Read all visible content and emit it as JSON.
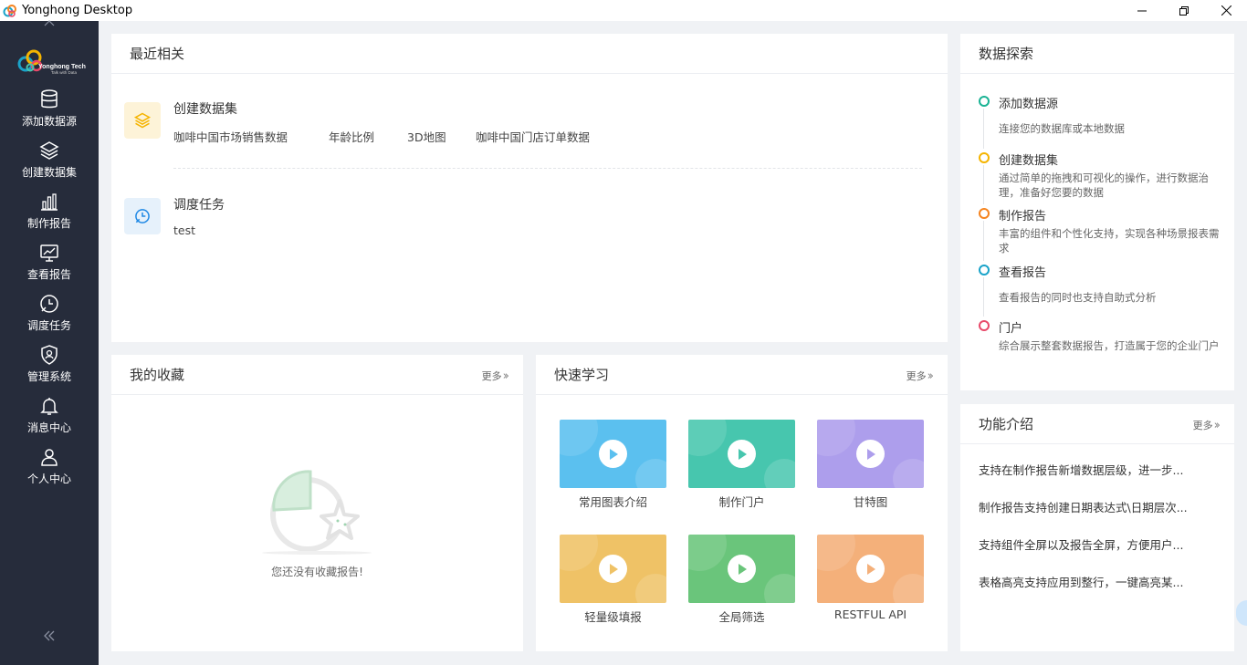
{
  "window": {
    "title": "Yonghong Desktop"
  },
  "sidebar": {
    "brand": {
      "name": "Yonghong Tech",
      "slogan": "Talk with Data"
    },
    "items": [
      {
        "label": "添加数据源",
        "icon": "database-icon"
      },
      {
        "label": "创建数据集",
        "icon": "layers-icon"
      },
      {
        "label": "制作报告",
        "icon": "bar-chart-icon"
      },
      {
        "label": "查看报告",
        "icon": "monitor-chart-icon"
      },
      {
        "label": "调度任务",
        "icon": "clock-icon"
      },
      {
        "label": "管理系统",
        "icon": "shield-user-icon"
      },
      {
        "label": "消息中心",
        "icon": "bell-icon"
      },
      {
        "label": "个人中心",
        "icon": "user-icon"
      }
    ]
  },
  "recent": {
    "title": "最近相关",
    "dataset": {
      "title": "创建数据集",
      "links": [
        "咖啡中国市场销售数据",
        "年龄比例",
        "3D地图",
        "咖啡中国门店订单数据"
      ]
    },
    "schedule": {
      "title": "调度任务",
      "links": [
        "test"
      ]
    }
  },
  "favorites": {
    "title": "我的收藏",
    "more": "更多",
    "empty_text": "您还没有收藏报告!"
  },
  "quick_learn": {
    "title": "快速学习",
    "more": "更多",
    "videos": [
      {
        "label": "常用图表介绍",
        "color": "#5bc0ef"
      },
      {
        "label": "制作门户",
        "color": "#47c6ae"
      },
      {
        "label": "甘特图",
        "color": "#ad9eec"
      },
      {
        "label": "轻量级填报",
        "color": "#efc266"
      },
      {
        "label": "全局筛选",
        "color": "#6ac57b"
      },
      {
        "label": "RESTFUL API",
        "color": "#f4b07a"
      }
    ]
  },
  "explore": {
    "title": "数据探索",
    "steps": [
      {
        "name": "添加数据源",
        "desc": "连接您的数据库或本地数据",
        "color": "#1ab394"
      },
      {
        "name": "创建数据集",
        "desc": "通过简单的拖拽和可视化的操作，进行数据治理，准备好您要的数据",
        "color": "#f5b400"
      },
      {
        "name": "制作报告",
        "desc": "丰富的组件和个性化支持，实现各种场景报表需求",
        "color": "#f5841f"
      },
      {
        "name": "查看报告",
        "desc": "查看报告的同时也支持自助式分析",
        "color": "#1aa3c9"
      },
      {
        "name": "门户",
        "desc": "综合展示整套数据报告，打造属于您的企业门户",
        "color": "#e84a6a"
      }
    ]
  },
  "features": {
    "title": "功能介绍",
    "more": "更多",
    "items": [
      "支持在制作报告新增数据层级，进一步...",
      "制作报告支持创建日期表达式\\日期层次...",
      "支持组件全屏以及报告全屏，方便用户...",
      "表格高亮支持应用到整行，一键高亮某..."
    ]
  }
}
